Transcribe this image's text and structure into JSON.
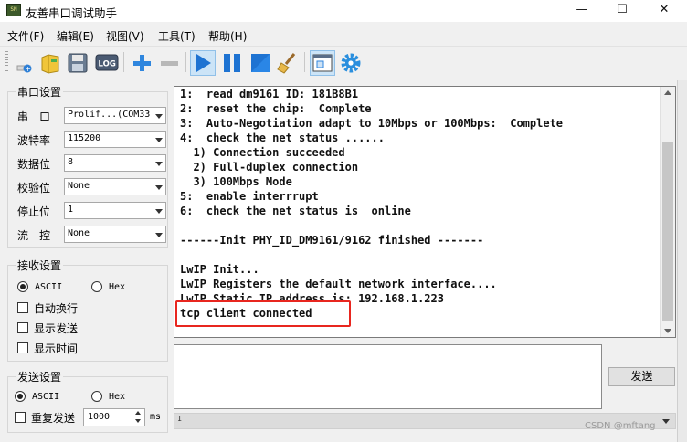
{
  "window": {
    "title": "友善串口调试助手",
    "icon_text": "SN",
    "minimize_label": "—",
    "maximize_label": "☐",
    "close_label": "✕"
  },
  "menu": [
    "文件(F)",
    "编辑(E)",
    "视图(V)",
    "工具(T)",
    "帮助(H)"
  ],
  "toolbar": {
    "buttons": [
      "new-icon",
      "open-icon",
      "save-icon",
      "log-icon",
      "add-icon",
      "remove-icon",
      "play-icon",
      "pause-icon",
      "stop-icon",
      "clear-icon",
      "new-window-icon",
      "settings-icon"
    ],
    "log_text": "LOG"
  },
  "serial_settings": {
    "title": "串口设置",
    "fields": [
      {
        "label": "串　口",
        "value": "Prolif...(COM33"
      },
      {
        "label": "波特率",
        "value": "115200"
      },
      {
        "label": "数据位",
        "value": "8"
      },
      {
        "label": "校验位",
        "value": "None"
      },
      {
        "label": "停止位",
        "value": "1"
      },
      {
        "label": "流　控",
        "value": "None"
      }
    ]
  },
  "receive_settings": {
    "title": "接收设置",
    "radio_ascii": "ASCII",
    "radio_hex": "Hex",
    "selected": "ASCII",
    "checkboxes": [
      "自动换行",
      "显示发送",
      "显示时间"
    ]
  },
  "send_settings": {
    "title": "发送设置",
    "radio_ascii": "ASCII",
    "radio_hex": "Hex",
    "selected": "ASCII",
    "repeat_label": "重复发送",
    "interval_value": "1000",
    "interval_unit": "ms"
  },
  "receive_text": [
    "1:  read dm9161 ID: 181B8B1",
    "2:  reset the chip:  Complete",
    "3:  Auto-Negotiation adapt to 10Mbps or 100Mbps:  Complete",
    "4:  check the net status ......",
    "  1) Connection succeeded",
    "  2) Full-duplex connection",
    "  3) 100Mbps Mode",
    "5:  enable interrrupt",
    "6:  check the net status is  online",
    "",
    "------Init PHY_ID_DM9161/9162 finished -------",
    "",
    "LwIP Init...",
    "LwIP Registers the default network interface....",
    "LwIP Static IP address is: 192.168.1.223",
    "tcp client connected"
  ],
  "send_button": "发送",
  "hscroll_mark": "1",
  "watermark": "CSDN @mftang",
  "colors": {
    "highlight": "#e8261f",
    "accent_blue": "#1e73d2"
  }
}
